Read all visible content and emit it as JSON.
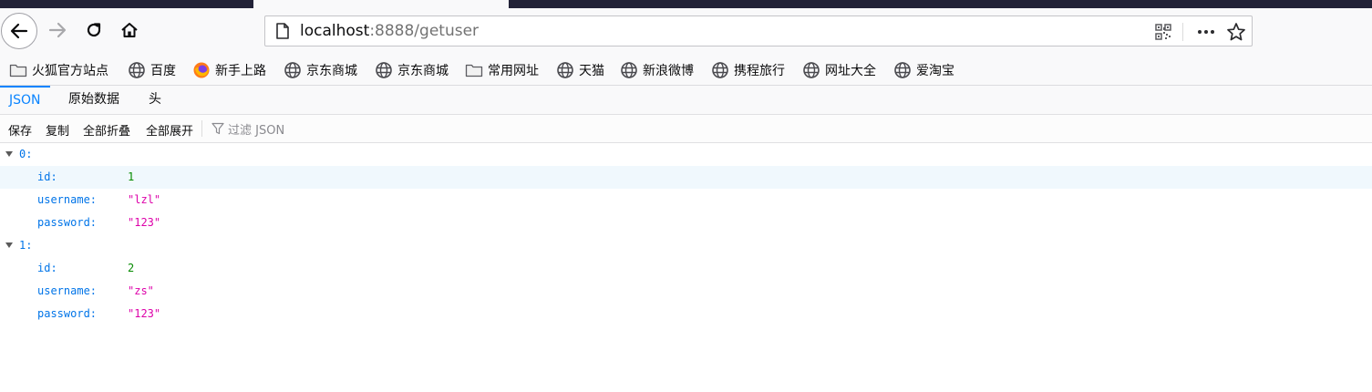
{
  "browser": {
    "url_host": "localhost",
    "url_rest": ":8888/getuser",
    "nav_icons": [
      "back-icon",
      "forward-icon",
      "reload-icon",
      "home-icon"
    ],
    "url_icons": [
      "page-icon",
      "qr-code-icon",
      "more-icon",
      "bookmark-star-icon"
    ]
  },
  "bookmarks": [
    {
      "label": "火狐官方站点",
      "icon": "folder-icon"
    },
    {
      "label": "百度",
      "icon": "globe-icon"
    },
    {
      "label": "新手上路",
      "icon": "firefox-icon"
    },
    {
      "label": "京东商城",
      "icon": "globe-icon"
    },
    {
      "label": "京东商城",
      "icon": "folder-icon"
    },
    {
      "label": "常用网址",
      "icon": "folder-icon"
    },
    {
      "label": "天猫",
      "icon": "globe-icon"
    },
    {
      "label": "新浪微博",
      "icon": "globe-icon"
    },
    {
      "label": "携程旅行",
      "icon": "globe-icon"
    },
    {
      "label": "网址大全",
      "icon": "globe-icon"
    },
    {
      "label": "爱淘宝",
      "icon": "globe-icon"
    }
  ],
  "viewer": {
    "tabs": [
      "JSON",
      "原始数据",
      "头"
    ],
    "selected_tab": "JSON",
    "toolbar": {
      "save": "保存",
      "copy": "复制",
      "collapse_all": "全部折叠",
      "expand_all": "全部展开",
      "filter_placeholder": "过滤 JSON"
    }
  },
  "json": [
    {
      "index": "0:",
      "fields": [
        {
          "key": "id:",
          "value": "1",
          "type": "number"
        },
        {
          "key": "username:",
          "value": "\"lzl\"",
          "type": "string"
        },
        {
          "key": "password:",
          "value": "\"123\"",
          "type": "string"
        }
      ]
    },
    {
      "index": "1:",
      "fields": [
        {
          "key": "id:",
          "value": "2",
          "type": "number"
        },
        {
          "key": "username:",
          "value": "\"zs\"",
          "type": "string"
        },
        {
          "key": "password:",
          "value": "\"123\"",
          "type": "string"
        }
      ]
    }
  ],
  "colors": {
    "accent": "#0a84ff",
    "json_key": "#0074e8",
    "json_number": "#058b00",
    "json_string": "#dd00a9",
    "row_highlight": "#f0f8fd"
  }
}
